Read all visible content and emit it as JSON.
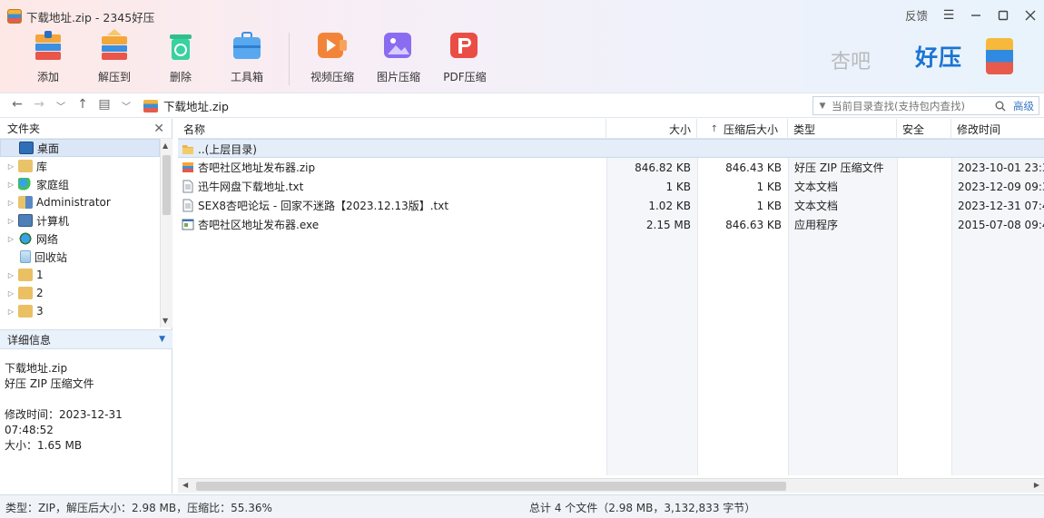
{
  "window": {
    "title": "下载地址.zip - 2345好压",
    "feedback": "反馈",
    "controls": [
      "menu-icon",
      "minimize-icon",
      "maximize-icon",
      "close-icon"
    ]
  },
  "toolbar": {
    "items": [
      {
        "label": "添加",
        "icon": "add-icon"
      },
      {
        "label": "解压到",
        "icon": "extract-icon"
      },
      {
        "label": "删除",
        "icon": "delete-icon"
      },
      {
        "label": "工具箱",
        "icon": "toolbox-icon"
      },
      {
        "label": "视频压缩",
        "icon": "video-compress-icon"
      },
      {
        "label": "图片压缩",
        "icon": "image-compress-icon"
      },
      {
        "label": "PDF压缩",
        "icon": "pdf-compress-icon"
      }
    ]
  },
  "brand": {
    "logo": "好压",
    "watermark": "杏吧"
  },
  "address": {
    "path": "下载地址.zip",
    "search_placeholder": "当前目录查找(支持包内查找)",
    "search_advanced": "高级"
  },
  "left_panel": {
    "title": "文件夹",
    "tree": [
      {
        "label": "桌面",
        "icon": "desktop-icon",
        "selected": true
      },
      {
        "label": "库",
        "icon": "library-icon"
      },
      {
        "label": "家庭组",
        "icon": "homegroup-icon"
      },
      {
        "label": "Administrator",
        "icon": "user-folder-icon"
      },
      {
        "label": "计算机",
        "icon": "computer-icon"
      },
      {
        "label": "网络",
        "icon": "network-icon"
      },
      {
        "label": "回收站",
        "icon": "recycle-bin-icon"
      },
      {
        "label": "1",
        "icon": "folder-icon"
      },
      {
        "label": "2",
        "icon": "folder-icon"
      },
      {
        "label": "3",
        "icon": "folder-icon"
      }
    ],
    "detail_title": "详细信息",
    "detail": {
      "name": "下载地址.zip",
      "type": "好压 ZIP 压缩文件",
      "modified": "修改时间：2023-12-31 07:48:52",
      "size": "大小：1.65 MB"
    }
  },
  "columns": {
    "name": "名称",
    "size": "大小",
    "packed": "压缩后大小",
    "type": "类型",
    "security": "安全",
    "modified": "修改时间"
  },
  "parent_row": "..(上层目录)",
  "files": [
    {
      "name": "杏吧社区地址发布器.zip",
      "size": "846.82 KB",
      "packed": "846.43 KB",
      "type": "好压 ZIP 压缩文件",
      "modified": "2023-10-01 23:3",
      "icon": "zip-file-icon"
    },
    {
      "name": "迅牛网盘下载地址.txt",
      "size": "1 KB",
      "packed": "1 KB",
      "type": "文本文档",
      "modified": "2023-12-09 09:3",
      "icon": "text-file-icon"
    },
    {
      "name": "SEX8杏吧论坛 - 回家不迷路【2023.12.13版】.txt",
      "size": "1.02 KB",
      "packed": "1 KB",
      "type": "文本文档",
      "modified": "2023-12-31 07:4",
      "icon": "text-file-icon"
    },
    {
      "name": "杏吧社区地址发布器.exe",
      "size": "2.15 MB",
      "packed": "846.63 KB",
      "type": "应用程序",
      "modified": "2015-07-08 09:4",
      "icon": "exe-file-icon"
    }
  ],
  "status": {
    "left": "类型：ZIP，解压后大小：2.98 MB，压缩比：55.36%",
    "right": "总计 4 个文件（2.98 MB，3,132,833 字节）"
  }
}
